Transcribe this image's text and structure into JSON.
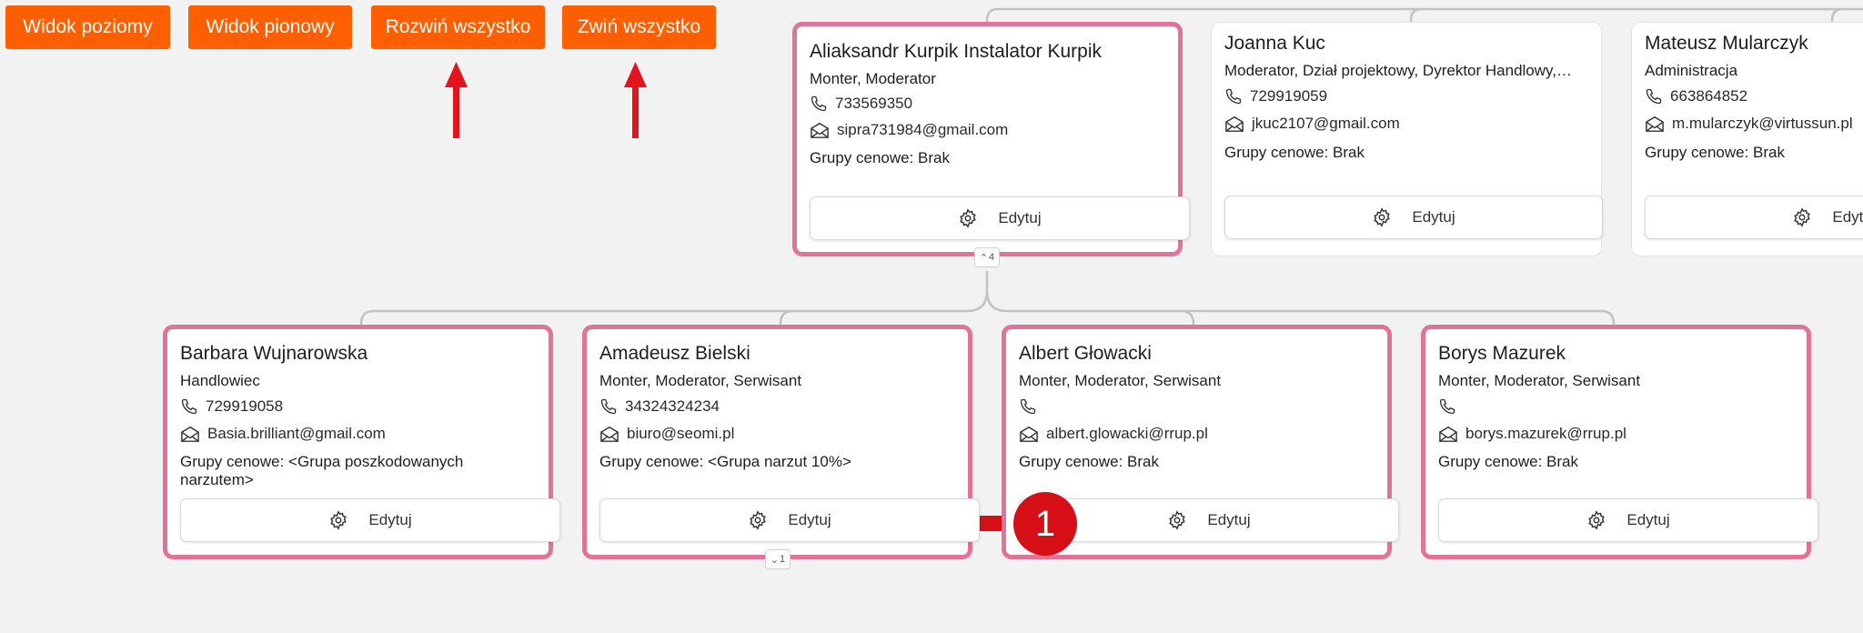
{
  "toolbar": {
    "horizontal_view": "Widok poziomy",
    "vertical_view": "Widok pionowy",
    "expand_all": "Rozwiń wszystko",
    "collapse_all": "Zwiń wszystko"
  },
  "top_cards": [
    {
      "name": "Aliaksandr Kurpik Instalator Kurpik",
      "role": "Monter, Moderator",
      "phone": "733569350",
      "email": "sipra731984@gmail.com",
      "prices": "Grupy cenowe: Brak",
      "edit": "Edytuj",
      "toggle": "4"
    },
    {
      "name": "Joanna Kuc",
      "role": "Moderator, Dział projektowy, Dyrektor Handlowy,…",
      "phone": "729919059",
      "email": "jkuc2107@gmail.com",
      "prices": "Grupy cenowe: Brak",
      "edit": "Edytuj"
    },
    {
      "name": "Mateusz Mularczyk",
      "role": "Administracja",
      "phone": "663864852",
      "email": "m.mularczyk@virtussun.pl",
      "prices": "Grupy cenowe: Brak",
      "edit": "Edytuj"
    }
  ],
  "child_cards": [
    {
      "name": "Barbara Wujnarowska",
      "role": "Handlowiec",
      "phone": "729919058",
      "email": "Basia.brilliant@gmail.com",
      "prices": "Grupy cenowe: <Grupa poszkodowanych narzutem>",
      "edit": "Edytuj"
    },
    {
      "name": "Amadeusz Bielski",
      "role": "Monter, Moderator, Serwisant",
      "phone": "34324324234",
      "email": "biuro@seomi.pl",
      "prices": "Grupy cenowe: <Grupa narzut 10%>",
      "edit": "Edytuj",
      "toggle": "1"
    },
    {
      "name": "Albert Głowacki",
      "role": "Monter, Moderator, Serwisant",
      "phone": "",
      "email": "albert.glowacki@rrup.pl",
      "prices": "Grupy cenowe: Brak",
      "edit": "Edytuj"
    },
    {
      "name": "Borys Mazurek",
      "role": "Monter, Moderator, Serwisant",
      "phone": "",
      "email": "borys.mazurek@rrup.pl",
      "prices": "Grupy cenowe: Brak",
      "edit": "Edytuj"
    }
  ],
  "annotations": {
    "step_badge": "1",
    "arrow_color": "#d60f17",
    "accent_color": "#ff5f00",
    "highlight_color": "#e27398"
  }
}
